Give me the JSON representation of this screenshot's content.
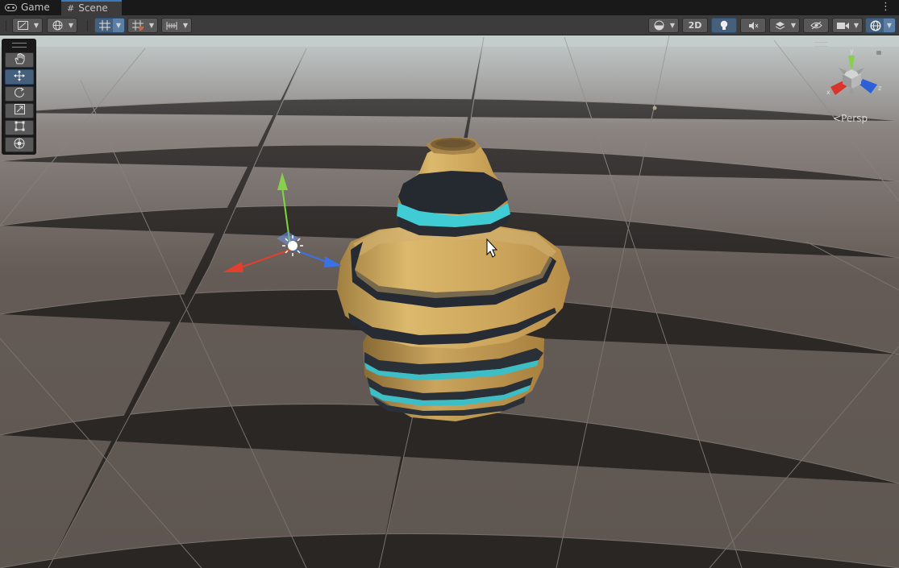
{
  "tabs": [
    {
      "label": "Game",
      "icon": "gamepad-icon",
      "active": false
    },
    {
      "label": "Scene",
      "icon": "grid-hash-icon",
      "active": true
    }
  ],
  "toolbar": {
    "mode_2d_label": "2D"
  },
  "scene": {
    "projection_label": "Persp",
    "axis_labels": {
      "x": "x",
      "y": "y",
      "z": "z"
    }
  },
  "tools": [
    {
      "name": "hand-tool-button",
      "icon": "hand-icon",
      "selected": false
    },
    {
      "name": "move-tool-button",
      "icon": "move-arrows-icon",
      "selected": true
    },
    {
      "name": "rotate-tool-button",
      "icon": "rotate-icon",
      "selected": false
    },
    {
      "name": "scale-tool-button",
      "icon": "scale-icon",
      "selected": false
    },
    {
      "name": "rect-tool-button",
      "icon": "rect-icon",
      "selected": false
    },
    {
      "name": "transform-tool-button",
      "icon": "transform-icon",
      "selected": false
    }
  ],
  "colors": {
    "accent": "#3a79bb",
    "axis_x": "#e0402c",
    "axis_y": "#86d04a",
    "axis_z": "#3a72e6",
    "vase_gold": "#c89e55",
    "vase_band_dark": "#252a30",
    "vase_band_cyan": "#3cc8d0",
    "scene_bg": "#5f5752"
  }
}
